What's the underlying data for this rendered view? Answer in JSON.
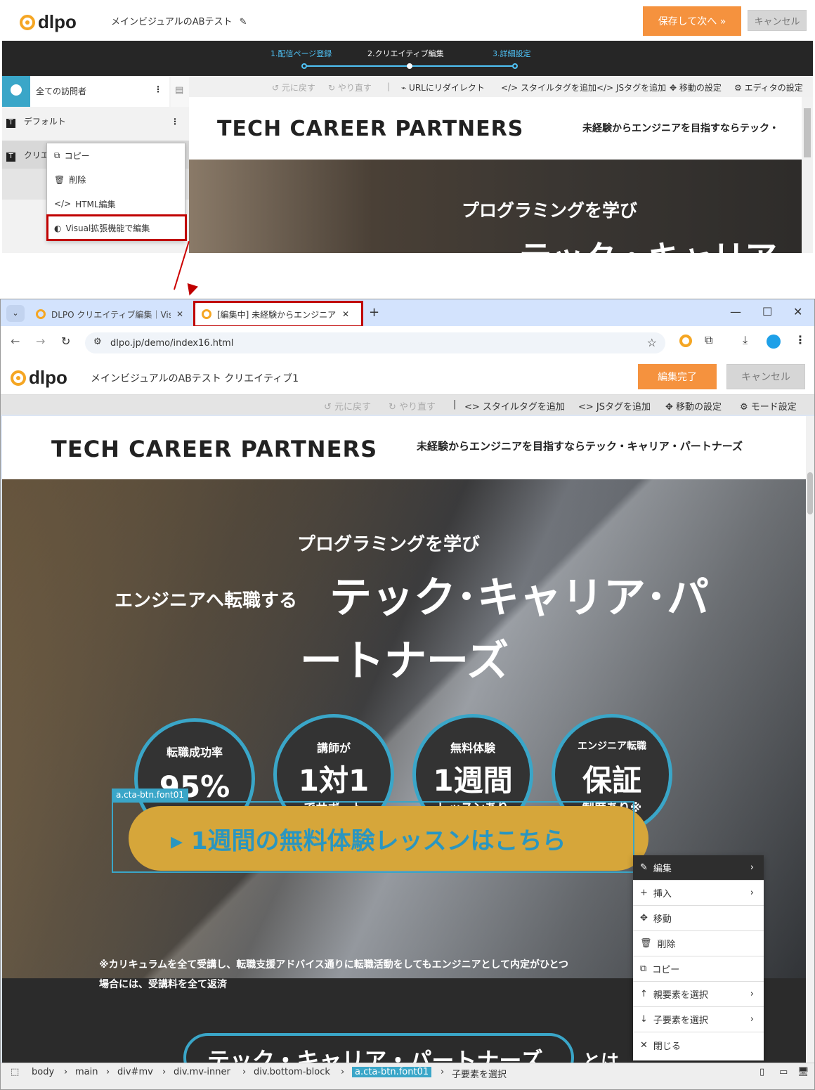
{
  "top": {
    "title": "メインビジュアルのABテスト",
    "save_next": "保存して次へ »",
    "cancel": "キャンセル",
    "steps": [
      "1.配信ページ登録",
      "2.クリエイティブ編集",
      "3.詳細設定"
    ],
    "sidebar": {
      "visitors": "全ての訪問者",
      "default": "デフォルト",
      "creative": "クリエ"
    },
    "toolbar": {
      "undo": "元に戻す",
      "redo": "やり直す",
      "redirect": "URLにリダイレクト",
      "style": "スタイルタグを追加",
      "js": "JSタグを追加",
      "move": "移動の設定",
      "editor": "エディタの設定"
    },
    "preview": {
      "brand": "TECH CAREER PARTNERS",
      "tagline": "未経験からエンジニアを目指すならテック・",
      "hero1": "プログラミングを学び",
      "hero2": "テック・キャリア"
    },
    "menu": [
      "コピー",
      "削除",
      "HTML編集",
      "Visual拡張機能で編集"
    ]
  },
  "browser": {
    "tab1": "DLPO クリエイティブ編集｜Visual拡",
    "tab2": "[編集中] 未経験からエンジニアを目",
    "url": "dlpo.jp/demo/index16.html",
    "title": "メインビジュアルのABテスト クリエイティブ1",
    "done": "編集完了",
    "cancel": "キャンセル",
    "toolbar": {
      "undo": "元に戻す",
      "redo": "やり直す",
      "style": "スタイルタグを追加",
      "js": "JSタグを追加",
      "move": "移動の設定",
      "mode": "モード設定"
    },
    "page": {
      "brand": "TECH CAREER PARTNERS",
      "tagline": "未経験からエンジニアを目指すならテック・キャリア・パートナーズ",
      "hero1": "プログラミングを学び",
      "hero2a": "エンジニアへ転職する",
      "hero2b": "テック･キャリア･パ",
      "hero3": "ートナーズ",
      "circles": [
        {
          "l1": "転職成功率",
          "l2": "95%",
          "l3": ""
        },
        {
          "l1": "講師が",
          "l2": "1対1",
          "l3": "でサポート"
        },
        {
          "l1": "無料体験",
          "l2": "1週間",
          "l3": "レッスンあり"
        },
        {
          "l1": "エンジニア転職",
          "l2": "保証",
          "l3": "制度あり※"
        }
      ],
      "selected_tag": "a.cta-btn.font01",
      "cta": "▸ 1週間の無料体験レッスンはこちら",
      "note1": "※カリキュラムを全て受講し、転職支援アドバイス通りに転職活動をしてもエンジニアとして内定がひとつ",
      "note2": "場合には、受講料を全て返済",
      "bottom_heading": "テック・キャリア・パートナーズ",
      "bottom_suffix": "とは"
    },
    "menu": [
      "編集",
      "挿入",
      "移動",
      "削除",
      "コピー",
      "親要素を選択",
      "子要素を選択",
      "閉じる"
    ],
    "breadcrumbs": [
      "body",
      "main",
      "div#mv",
      "div.mv-inner",
      "div.bottom-block",
      "a.cta-btn.font01",
      "子要素を選択"
    ]
  },
  "colors": {
    "accent": "#f5923e",
    "highlight": "#c00000",
    "teal": "#3aa6c8",
    "gold": "#d6a63a"
  }
}
